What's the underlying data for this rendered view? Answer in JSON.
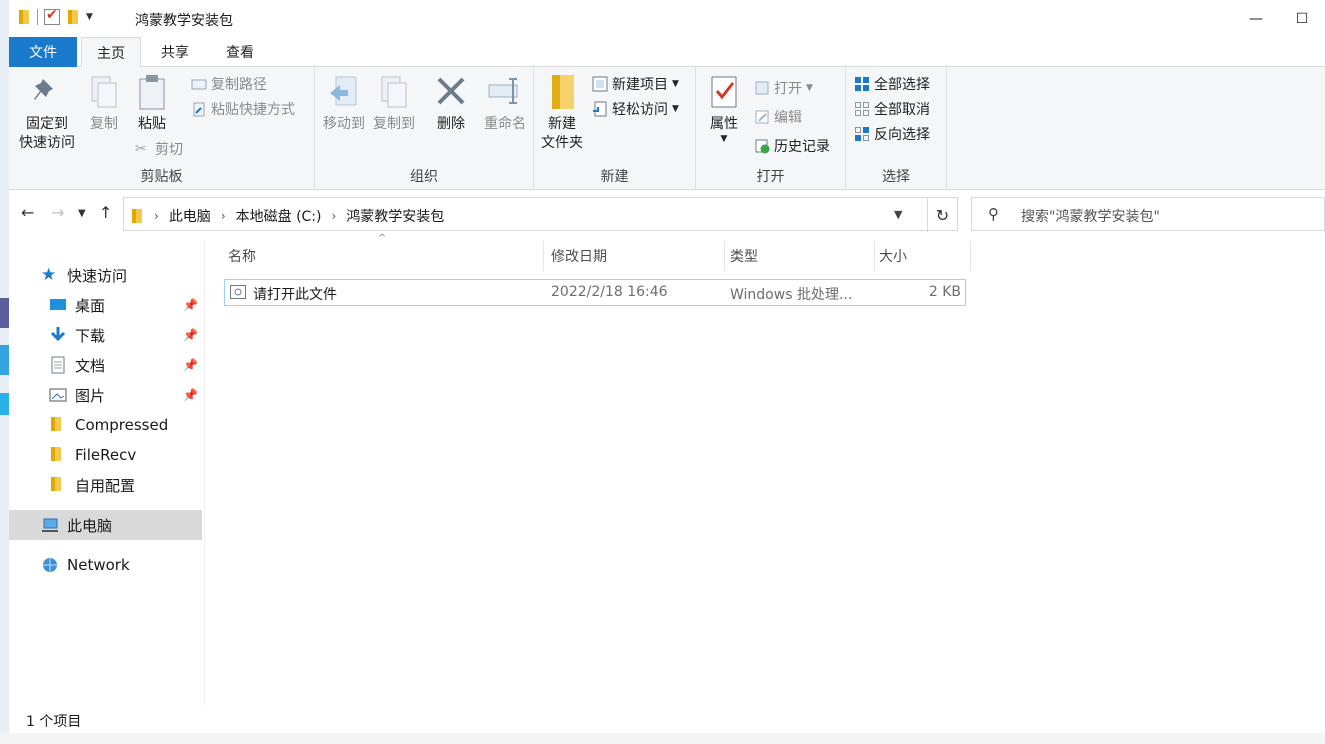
{
  "window": {
    "title": "鸿蒙教学安装包",
    "controls": {
      "minimize": "—",
      "maximize": "☐"
    }
  },
  "ribbon": {
    "tabs": {
      "file": "文件",
      "home": "主页",
      "share": "共享",
      "view": "查看"
    },
    "clipboard": {
      "label": "剪贴板",
      "pin_line1": "固定到",
      "pin_line2": "快速访问",
      "copy": "复制",
      "paste": "粘贴",
      "copy_path": "复制路径",
      "paste_shortcut": "粘贴快捷方式",
      "cut": "剪切"
    },
    "organize": {
      "label": "组织",
      "move_to": "移动到",
      "copy_to": "复制到",
      "delete": "删除",
      "rename": "重命名"
    },
    "new": {
      "label": "新建",
      "new_folder_line1": "新建",
      "new_folder_line2": "文件夹",
      "new_item": "新建项目",
      "easy_access": "轻松访问"
    },
    "open": {
      "label": "打开",
      "properties": "属性",
      "open": "打开",
      "edit": "编辑",
      "history": "历史记录"
    },
    "select": {
      "label": "选择",
      "select_all": "全部选择",
      "select_none": "全部取消",
      "invert": "反向选择"
    }
  },
  "address": {
    "crumbs": [
      "此电脑",
      "本地磁盘 (C:)",
      "鸿蒙教学安装包"
    ],
    "search_placeholder": "搜索\"鸿蒙教学安装包\""
  },
  "navpane": {
    "quick_access": "快速访问",
    "pinned": [
      "桌面",
      "下载",
      "文档",
      "图片"
    ],
    "folders": [
      "Compressed",
      "FileRecv",
      "自用配置"
    ],
    "this_pc": "此电脑",
    "network": "Network"
  },
  "columns": {
    "name": "名称",
    "modified": "修改日期",
    "type": "类型",
    "size": "大小"
  },
  "files": [
    {
      "name": "请打开此文件",
      "modified": "2022/2/18 16:46",
      "type": "Windows 批处理...",
      "size": "2 KB"
    }
  ],
  "status": {
    "count": "1 个项目"
  },
  "colors": {
    "accent": "#1979ca",
    "selection_border": "#99d1ff",
    "folder": "#f2c94c"
  }
}
